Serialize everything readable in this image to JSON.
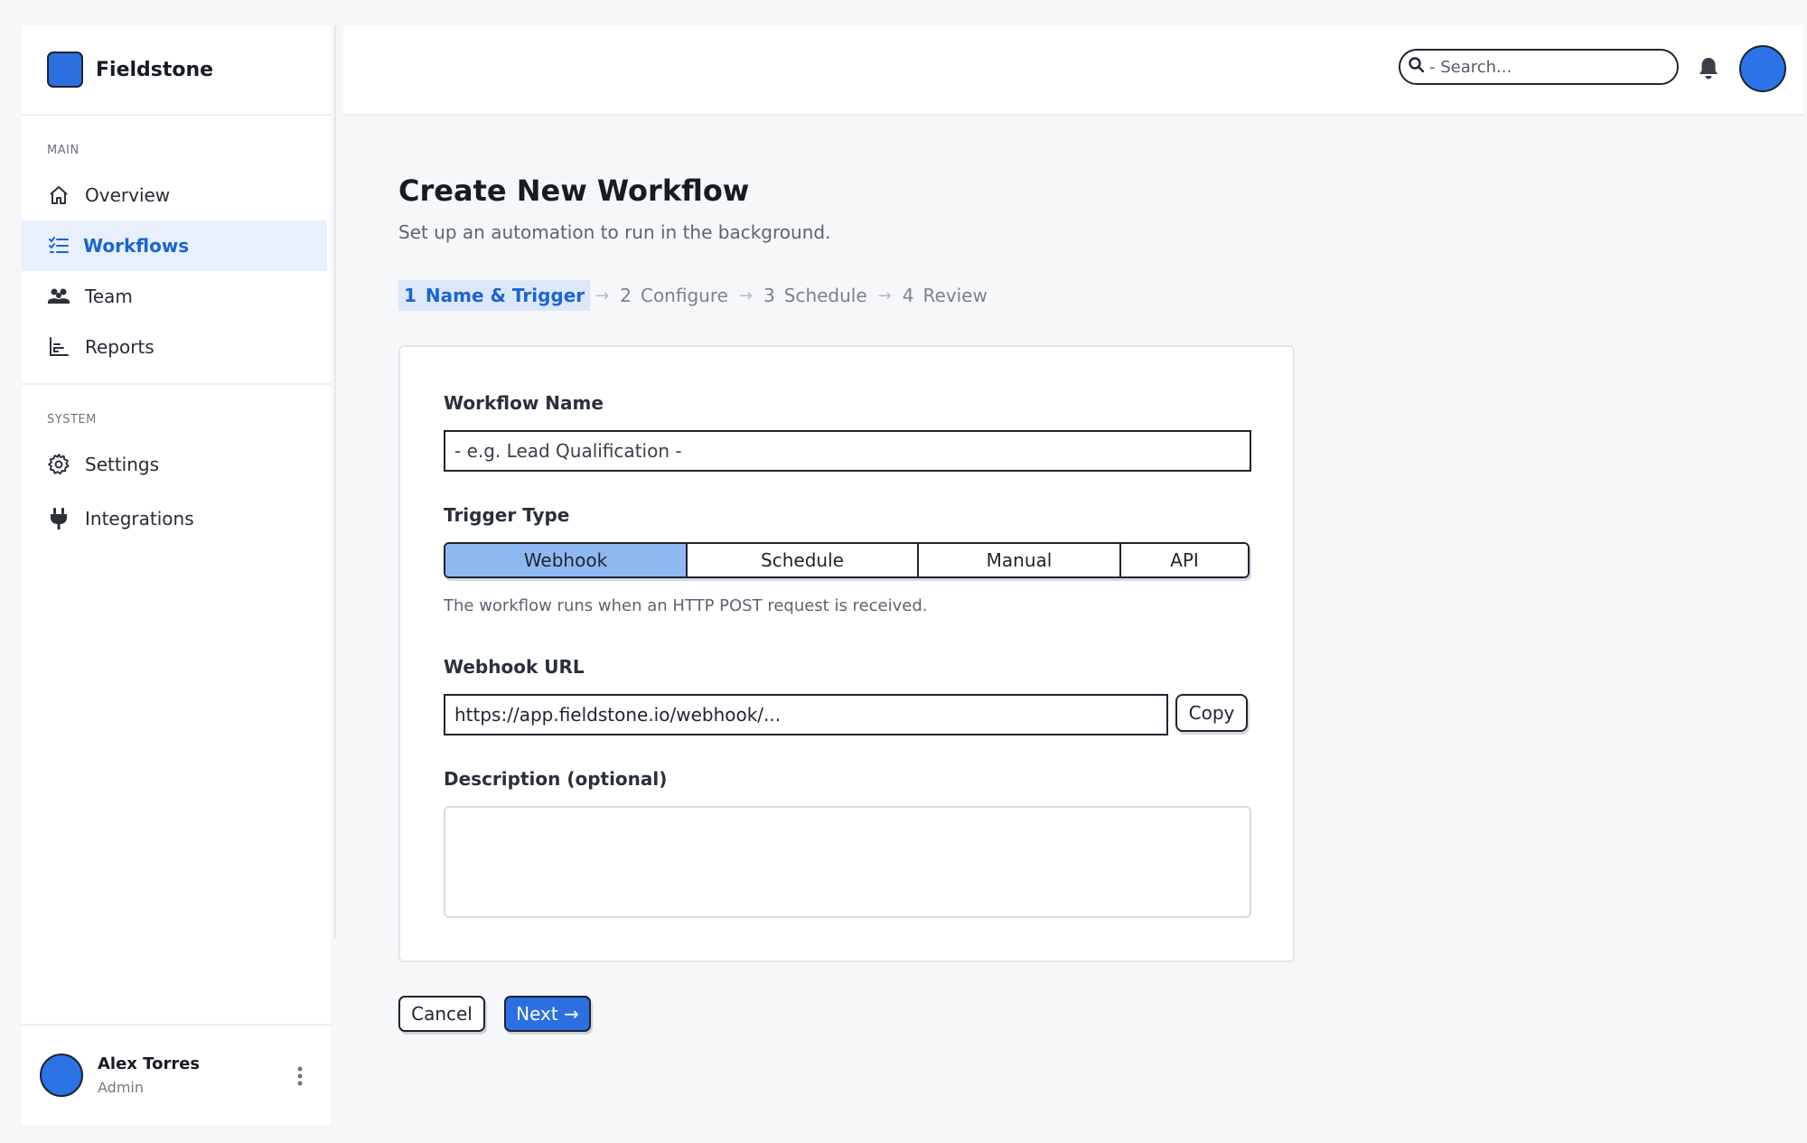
{
  "app": {
    "brand_name": "Fieldstone"
  },
  "sidebar": {
    "sections": [
      {
        "label": "MAIN",
        "items": [
          {
            "label": "Overview",
            "icon": "home-icon",
            "active": false
          },
          {
            "label": "Workflows",
            "icon": "checklist-icon",
            "active": true
          },
          {
            "label": "Team",
            "icon": "users-icon",
            "active": false
          },
          {
            "label": "Reports",
            "icon": "bar-chart-icon",
            "active": false
          }
        ]
      },
      {
        "label": "SYSTEM",
        "items": [
          {
            "label": "Settings",
            "icon": "gear-icon",
            "active": false
          },
          {
            "label": "Integrations",
            "icon": "plug-icon",
            "active": false
          }
        ]
      }
    ],
    "user": {
      "name": "Alex Torres",
      "role": "Admin"
    }
  },
  "topbar": {
    "search_placeholder": "- Search..."
  },
  "page": {
    "title": "Create New Workflow",
    "subtitle": "Set up an automation to run in the background."
  },
  "stepper": {
    "steps": [
      {
        "num": "1",
        "label": "Name & Trigger",
        "active": true
      },
      {
        "num": "2",
        "label": "Configure",
        "active": false
      },
      {
        "num": "3",
        "label": "Schedule",
        "active": false
      },
      {
        "num": "4",
        "label": "Review",
        "active": false
      }
    ],
    "arrow": "→"
  },
  "form": {
    "name_label": "Workflow Name",
    "name_placeholder": "- e.g. Lead Qualification -",
    "trigger_label": "Trigger Type",
    "trigger_options": [
      {
        "label": "Webhook",
        "active": true
      },
      {
        "label": "Schedule",
        "active": false
      },
      {
        "label": "Manual",
        "active": false
      },
      {
        "label": "API",
        "active": false
      }
    ],
    "trigger_help": "The workflow runs when an HTTP POST request is received.",
    "webhook_label": "Webhook URL",
    "webhook_value": "https://app.fieldstone.io/webhook/...",
    "copy_label": "Copy",
    "description_label": "Description (optional)",
    "description_value": ""
  },
  "actions": {
    "cancel_label": "Cancel",
    "next_label": "Next →"
  },
  "colors": {
    "accent": "#2b6fe0",
    "active_nav_bg": "#e7f0fc",
    "active_segment": "#8eb8f2"
  }
}
